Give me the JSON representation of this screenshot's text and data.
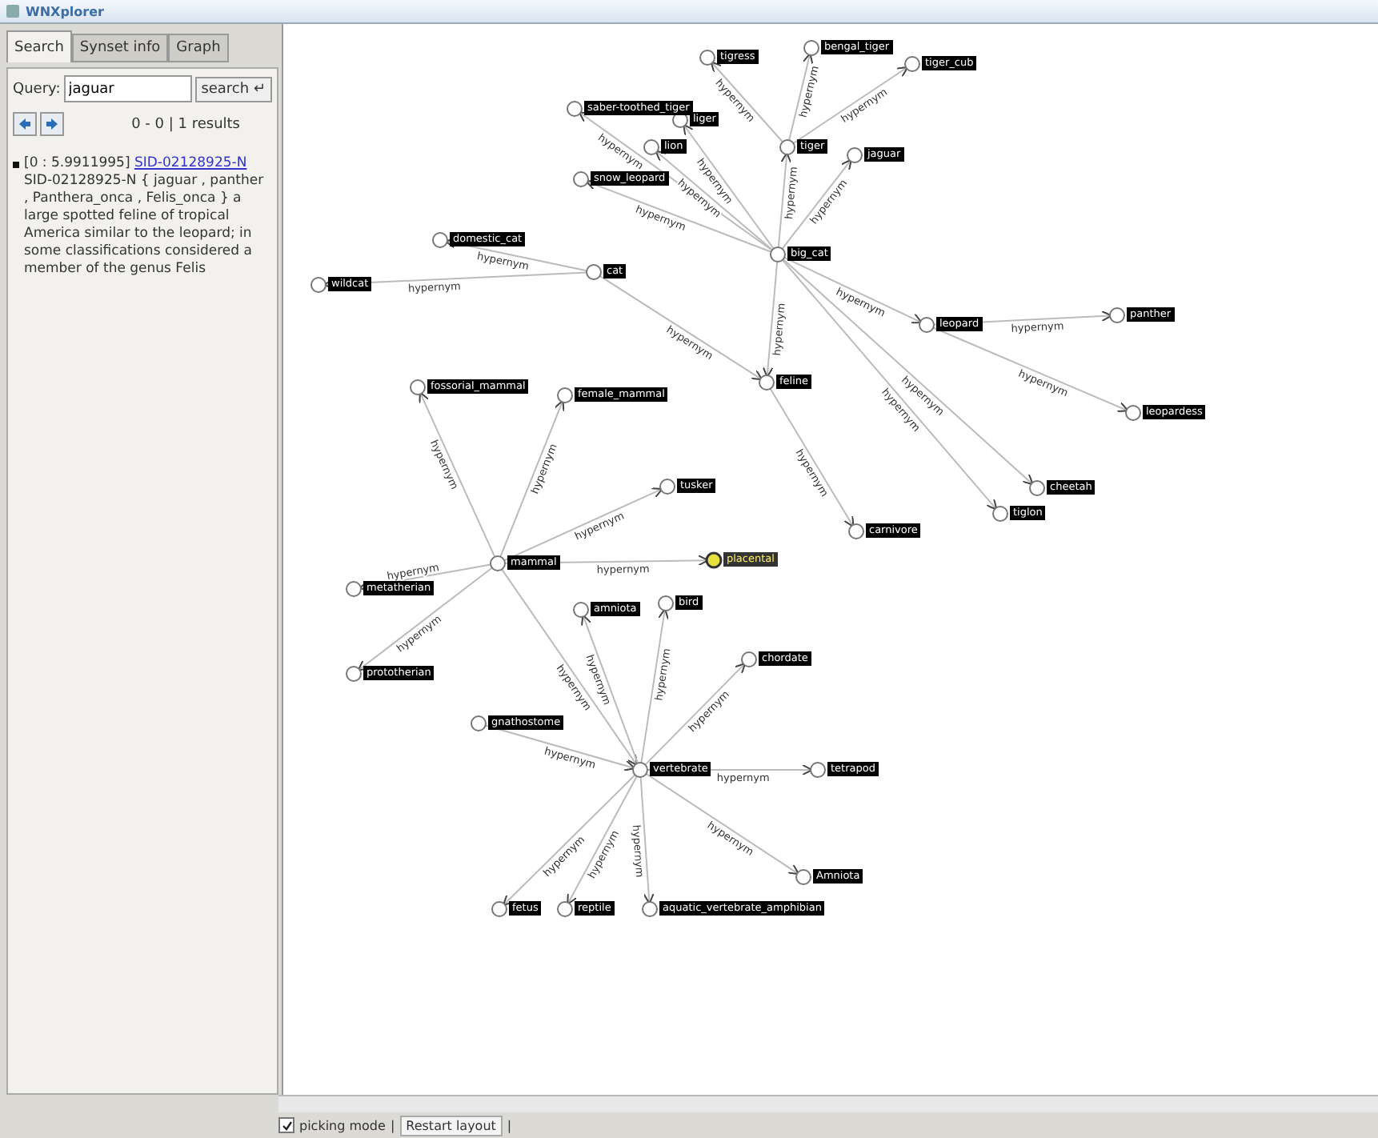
{
  "window": {
    "title": "WNXplorer"
  },
  "tabs": [
    {
      "label": "Search",
      "selected": true
    },
    {
      "label": "Synset info",
      "selected": false
    },
    {
      "label": "Graph",
      "selected": false
    }
  ],
  "query": {
    "label": "Query:",
    "value": "jaguar",
    "button": "search ↵"
  },
  "results_summary": "0 - 0 | 1 results",
  "results": [
    {
      "score": "[0 : 5.9911995] ",
      "link": "SID-02128925-N",
      "text": "SID-02128925-N { jaguar , panther , Panthera_onca , Felis_onca } a large spotted feline of tropical America similar to the leopard; in some classifications considered a member of the genus Felis"
    }
  ],
  "graph": {
    "nodes": [
      {
        "label": "tigress",
        "highlighted": false
      },
      {
        "label": "bengal_tiger",
        "highlighted": false
      },
      {
        "label": "tiger_cub",
        "highlighted": false
      },
      {
        "label": "saber-toothed_tiger",
        "highlighted": false
      },
      {
        "label": "liger",
        "highlighted": false
      },
      {
        "label": "tiger",
        "highlighted": false
      },
      {
        "label": "lion",
        "highlighted": false
      },
      {
        "label": "jaguar",
        "highlighted": false
      },
      {
        "label": "snow_leopard",
        "highlighted": false
      },
      {
        "label": "domestic_cat",
        "highlighted": false
      },
      {
        "label": "big_cat",
        "highlighted": false
      },
      {
        "label": "wildcat",
        "highlighted": false
      },
      {
        "label": "cat",
        "highlighted": false
      },
      {
        "label": "leopard",
        "highlighted": false
      },
      {
        "label": "panther",
        "highlighted": false
      },
      {
        "label": "fossorial_mammal",
        "highlighted": false
      },
      {
        "label": "female_mammal",
        "highlighted": false
      },
      {
        "label": "feline",
        "highlighted": false
      },
      {
        "label": "leopardess",
        "highlighted": false
      },
      {
        "label": "tusker",
        "highlighted": false
      },
      {
        "label": "cheetah",
        "highlighted": false
      },
      {
        "label": "tiglon",
        "highlighted": false
      },
      {
        "label": "carnivore",
        "highlighted": false
      },
      {
        "label": "mammal",
        "highlighted": false
      },
      {
        "label": "placental",
        "highlighted": true
      },
      {
        "label": "metatherian",
        "highlighted": false
      },
      {
        "label": "amniota",
        "highlighted": false
      },
      {
        "label": "bird",
        "highlighted": false
      },
      {
        "label": "chordate",
        "highlighted": false
      },
      {
        "label": "prototherian",
        "highlighted": false
      },
      {
        "label": "gnathostome",
        "highlighted": false
      },
      {
        "label": "vertebrate",
        "highlighted": false
      },
      {
        "label": "tetrapod",
        "highlighted": false
      },
      {
        "label": "Amniota",
        "highlighted": false
      },
      {
        "label": "fetus",
        "highlighted": false
      },
      {
        "label": "reptile",
        "highlighted": false
      },
      {
        "label": "aquatic_vertebrate_amphibian",
        "highlighted": false
      }
    ],
    "edges": [
      {
        "label": "hypernym"
      },
      {
        "label": "hypernym"
      },
      {
        "label": "hypernym"
      },
      {
        "label": "hypernym"
      },
      {
        "label": "hypernym"
      },
      {
        "label": "hypernym"
      },
      {
        "label": "hypernym"
      },
      {
        "label": "hypernym"
      },
      {
        "label": "hypernym"
      },
      {
        "label": "hypernym"
      },
      {
        "label": "hypernym"
      },
      {
        "label": "hypernym"
      },
      {
        "label": "hypernym"
      },
      {
        "label": "hypernym"
      },
      {
        "label": "hypernym"
      },
      {
        "label": "hypernym"
      },
      {
        "label": "hypernym"
      },
      {
        "label": "hypernym"
      },
      {
        "label": "hypernym"
      },
      {
        "label": "hypernym"
      },
      {
        "label": "hypernym"
      },
      {
        "label": "hypernym"
      },
      {
        "label": "hypernym"
      },
      {
        "label": "hypernym"
      },
      {
        "label": "hypernym"
      },
      {
        "label": "hypernym"
      },
      {
        "label": "hypernym"
      },
      {
        "label": "hypernym"
      },
      {
        "label": "hypernym"
      },
      {
        "label": "hypernym"
      },
      {
        "label": "hypernym"
      },
      {
        "label": "hypernym"
      },
      {
        "label": "hypernym"
      },
      {
        "label": "hypernym"
      },
      {
        "label": "hypernym"
      }
    ]
  },
  "bottom_bar": {
    "picking_mode": {
      "label": "picking mode",
      "checked": true
    },
    "separator": "|",
    "restart_button": "Restart layout",
    "separator_end": "|"
  }
}
